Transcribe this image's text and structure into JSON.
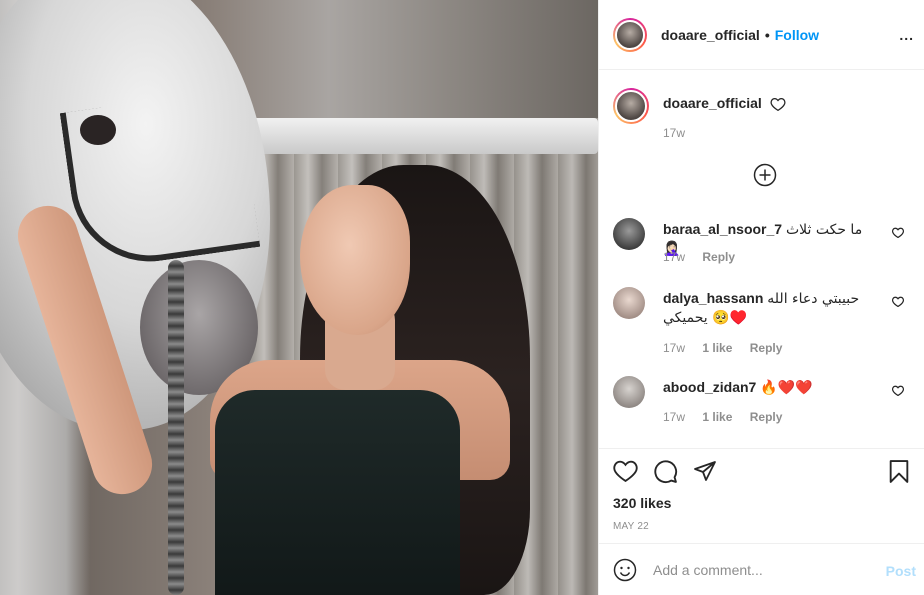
{
  "header": {
    "username": "doaare_official",
    "separator": "•",
    "follow_label": "Follow",
    "more": "..."
  },
  "caption": {
    "username": "doaare_official",
    "time": "17w"
  },
  "comments": [
    {
      "username": "baraa_al_nsoor_7",
      "text": "ما حكت ثلاث 🤦🏻‍♀️",
      "time": "17w",
      "reply": "Reply",
      "likes": ""
    },
    {
      "username": "dalya_hassann",
      "text": "حبيبتي دعاء الله يحميكي 🥺♥️",
      "time": "17w",
      "likes": "1 like",
      "reply": "Reply"
    },
    {
      "username": "abood_zidan7",
      "text": "🔥❤️❤️",
      "time": "17w",
      "likes": "1 like",
      "reply": "Reply"
    }
  ],
  "actions": {
    "likes": "320 likes",
    "date": "MAY 22"
  },
  "add_comment": {
    "placeholder": "Add a comment...",
    "post_label": "Post"
  },
  "colors": {
    "link": "#0095f6",
    "muted": "#8e8e8e",
    "post_disabled": "#b2dffc"
  },
  "icons": [
    "heart-icon",
    "comment-icon",
    "share-icon",
    "bookmark-icon",
    "plus-circle-icon",
    "emoji-icon",
    "more-icon"
  ]
}
